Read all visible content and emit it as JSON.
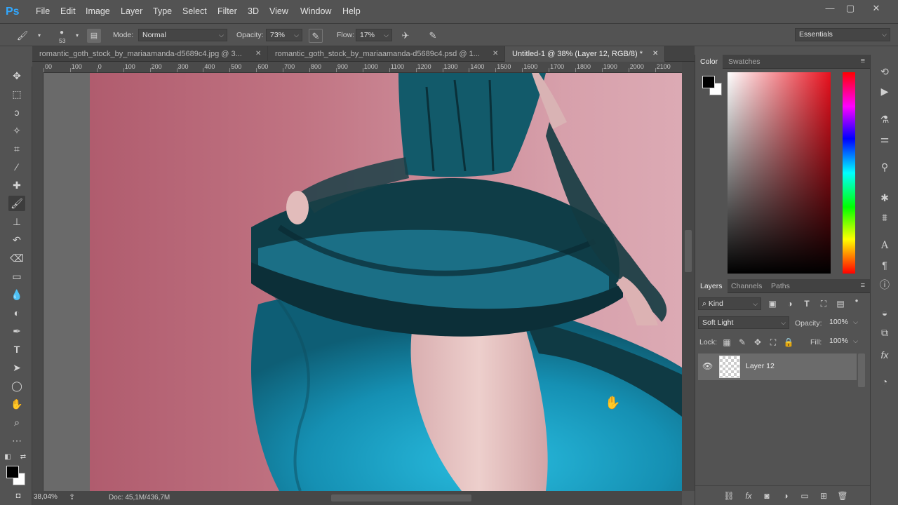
{
  "app": {
    "logo": "Ps"
  },
  "menu": [
    "File",
    "Edit",
    "Image",
    "Layer",
    "Type",
    "Select",
    "Filter",
    "3D",
    "View",
    "Window",
    "Help"
  ],
  "window_controls": {
    "minimize": "—",
    "restore": "▢",
    "close": "✕"
  },
  "options": {
    "brush_size": "53",
    "mode_label": "Mode:",
    "mode_value": "Normal",
    "opacity_label": "Opacity:",
    "opacity_value": "73%",
    "flow_label": "Flow:",
    "flow_value": "17%",
    "workspace": "Essentials"
  },
  "tabs": [
    {
      "label": "romantic_goth_stock_by_mariaamanda-d5689c4.jpg @ 3...",
      "active": false
    },
    {
      "label": "romantic_goth_stock_by_mariaamanda-d5689c4.psd @ 1...",
      "active": false
    },
    {
      "label": "Untitled-1 @ 38% (Layer 12, RGB/8) *",
      "active": true
    }
  ],
  "ruler": {
    "labels": [
      "00",
      "100",
      "0",
      "100",
      "200",
      "300",
      "400",
      "500",
      "600",
      "700",
      "800",
      "900",
      "1000",
      "1100",
      "1200",
      "1300",
      "1400",
      "1500",
      "1600",
      "1700",
      "1800",
      "1900",
      "2000",
      "2100"
    ]
  },
  "status": {
    "zoom": "38,04%",
    "doc": "Doc: 45,1M/436,7M"
  },
  "color_panel": {
    "tabs": [
      "Color",
      "Swatches"
    ],
    "foreground": "#000000",
    "background": "#ffffff"
  },
  "layers_panel": {
    "tabs": [
      "Layers",
      "Channels",
      "Paths"
    ],
    "filter_kind": "Kind",
    "blend_mode": "Soft Light",
    "opacity_label": "Opacity:",
    "opacity_value": "100%",
    "lock_label": "Lock:",
    "fill_label": "Fill:",
    "fill_value": "100%",
    "layers": [
      {
        "name": "Layer 12",
        "visible": true,
        "selected": true
      }
    ]
  },
  "canvas_colors": {
    "background_left": "#b05c6e",
    "background_right": "#dcaab4",
    "dress": "#1a8aa8",
    "dress_dark": "#0f3d47",
    "skin": "#e9c3c0"
  }
}
